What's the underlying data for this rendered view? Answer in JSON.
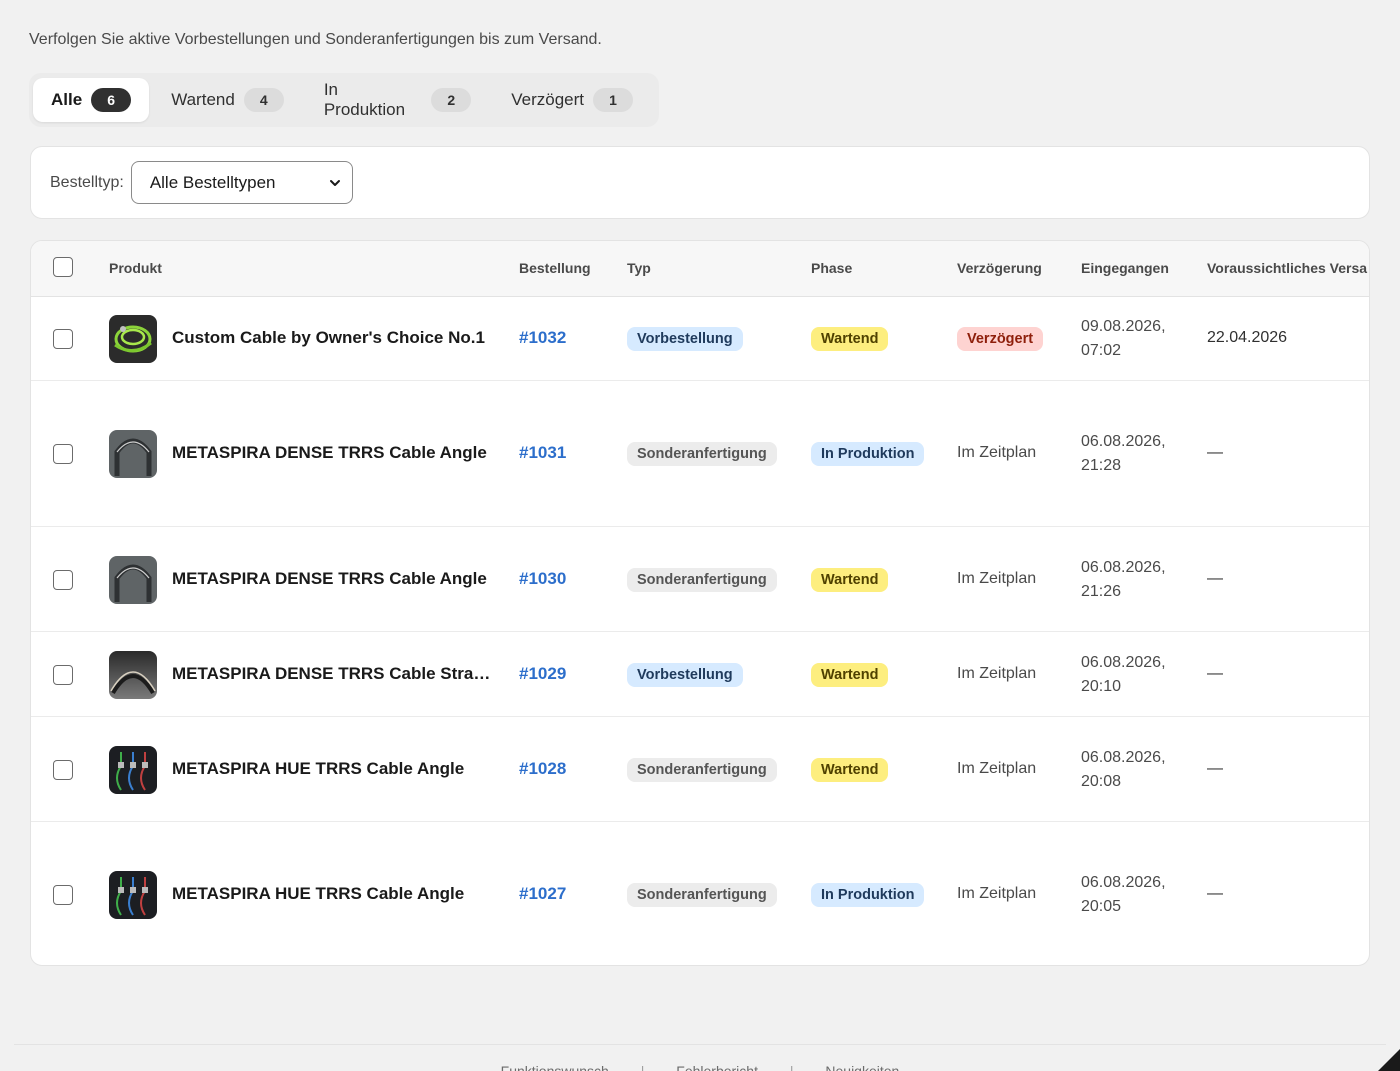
{
  "subtitle": "Verfolgen Sie aktive Vorbestellungen und Sonderanfertigungen bis zum Versand.",
  "tabs": [
    {
      "label": "Alle",
      "count": "6",
      "active": true
    },
    {
      "label": "Wartend",
      "count": "4"
    },
    {
      "label": "In Produktion",
      "count": "2"
    },
    {
      "label": "Verzögert",
      "count": "1"
    }
  ],
  "filter": {
    "label": "Bestelltyp:",
    "selected": "Alle Bestelltypen"
  },
  "table": {
    "headers": {
      "product": "Produkt",
      "order": "Bestellung",
      "type": "Typ",
      "phase": "Phase",
      "delay": "Verzögerung",
      "received": "Eingegangen",
      "eta": "Voraussichtliches Versa"
    },
    "rows": [
      {
        "product": "Custom Cable by Owner's Choice No.1",
        "thumb": "green-coil",
        "order": "#1032",
        "type": "Vorbestellung",
        "type_tone": "info",
        "phase": "Wartend",
        "phase_tone": "warn",
        "delay": "Verzögert",
        "delay_tone": "crit",
        "date": "09.08.2026,",
        "time": "07:02",
        "eta": "22.04.2026"
      },
      {
        "product": "METASPIRA DENSE TRRS Cable Angle",
        "thumb": "grey-arc",
        "order": "#1031",
        "type": "Sonderanfertigung",
        "type_tone": "neutral",
        "phase": "In Produktion",
        "phase_tone": "info",
        "delay": "Im Zeitplan",
        "delay_tone": "plain",
        "date": "06.08.2026,",
        "time": "21:28",
        "eta": "—"
      },
      {
        "product": "METASPIRA DENSE TRRS Cable Angle",
        "thumb": "grey-arc",
        "order": "#1030",
        "type": "Sonderanfertigung",
        "type_tone": "neutral",
        "phase": "Wartend",
        "phase_tone": "warn",
        "delay": "Im Zeitplan",
        "delay_tone": "plain",
        "date": "06.08.2026,",
        "time": "21:26",
        "eta": "—"
      },
      {
        "product": "METASPIRA DENSE TRRS Cable Stra…",
        "thumb": "dark-arc",
        "order": "#1029",
        "type": "Vorbestellung",
        "type_tone": "info",
        "phase": "Wartend",
        "phase_tone": "warn",
        "delay": "Im Zeitplan",
        "delay_tone": "plain",
        "date": "06.08.2026,",
        "time": "20:10",
        "eta": "—"
      },
      {
        "product": "METASPIRA HUE TRRS Cable Angle",
        "thumb": "hue",
        "order": "#1028",
        "type": "Sonderanfertigung",
        "type_tone": "neutral",
        "phase": "Wartend",
        "phase_tone": "warn",
        "delay": "Im Zeitplan",
        "delay_tone": "plain",
        "date": "06.08.2026,",
        "time": "20:08",
        "eta": "—"
      },
      {
        "product": "METASPIRA HUE TRRS Cable Angle",
        "thumb": "hue",
        "order": "#1027",
        "type": "Sonderanfertigung",
        "type_tone": "neutral",
        "phase": "In Produktion",
        "phase_tone": "info",
        "delay": "Im Zeitplan",
        "delay_tone": "plain",
        "date": "06.08.2026,",
        "time": "20:05",
        "eta": "—"
      }
    ]
  },
  "footer": {
    "links": [
      "Funktionswunsch",
      "Fehlerbericht",
      "Neuigkeiten"
    ]
  }
}
